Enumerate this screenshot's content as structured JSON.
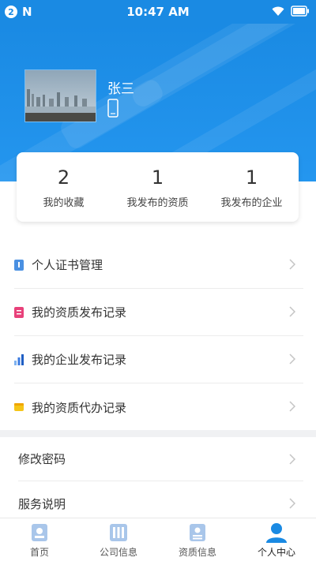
{
  "status_bar": {
    "badge": "2",
    "network_letter": "N",
    "time": "10:47 AM"
  },
  "profile": {
    "name": "张三"
  },
  "stats": [
    {
      "value": "2",
      "label": "我的收藏"
    },
    {
      "value": "1",
      "label": "我发布的资质"
    },
    {
      "value": "1",
      "label": "我发布的企业"
    }
  ],
  "menu": [
    {
      "label": "个人证书管理",
      "icon": "certificate-icon",
      "color": "#4a90e2"
    },
    {
      "label": "我的资质发布记录",
      "icon": "qualification-record-icon",
      "color": "#e8417a"
    },
    {
      "label": "我的企业发布记录",
      "icon": "bar-chart-icon",
      "color": "#3b7be0"
    },
    {
      "label": "我的资质代办记录",
      "icon": "agency-record-icon",
      "color": "#f5c518"
    }
  ],
  "settings": [
    {
      "label": "修改密码"
    },
    {
      "label": "服务说明"
    }
  ],
  "tabs": [
    {
      "label": "首页",
      "icon": "home-icon",
      "active": false
    },
    {
      "label": "公司信息",
      "icon": "company-icon",
      "active": false
    },
    {
      "label": "资质信息",
      "icon": "qualification-icon",
      "active": false
    },
    {
      "label": "个人中心",
      "icon": "user-icon",
      "active": true
    }
  ],
  "colors": {
    "primary": "#1a8ae3",
    "tab_inactive": "#a9c6ea",
    "tab_active": "#1a8ae3"
  }
}
